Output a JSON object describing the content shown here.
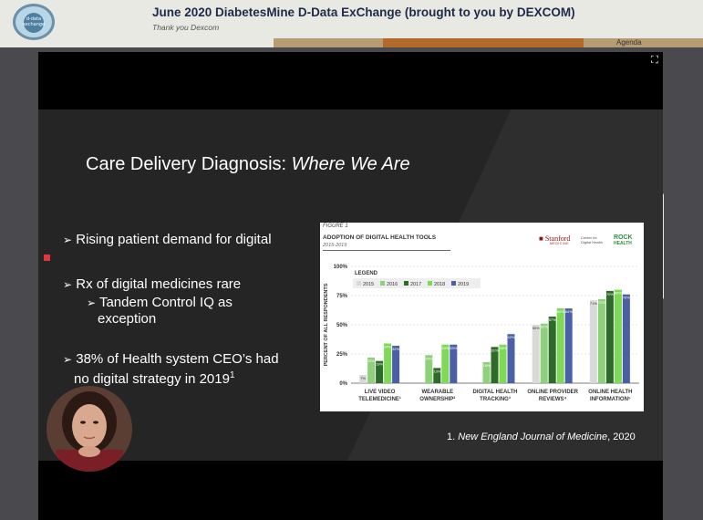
{
  "header": {
    "title": "June 2020 DiabetesMine D-Data ExChange (brought to you by DEXCOM)",
    "subtitle": "Thank you Dexcom",
    "agenda": "Agenda",
    "logo_line1": "d-data",
    "logo_line2": "exchange"
  },
  "slide": {
    "title_plain": "Care Delivery Diagnosis: ",
    "title_italic": "Where We Are",
    "bullets": [
      {
        "text": "Rising patient demand for digital"
      },
      {
        "text": "Rx of digital medicines rare"
      },
      {
        "text": "Tandem Control IQ as"
      },
      {
        "text": "exception"
      },
      {
        "text": "38% of Health system CEO’s had"
      },
      {
        "text": "no digital strategy in 2019"
      }
    ],
    "superscript": "1",
    "arrow": "➢",
    "footnote_num": "1.",
    "footnote_italic": "New England Journal of Medicine",
    "footnote_tail": ", 2020"
  },
  "figure": {
    "label": "FIGURE 1",
    "title": "ADOPTION OF DIGITAL HEALTH TOOLS",
    "years": "2015-2019",
    "stanford": "Stanford",
    "stanford_sub": "MEDICINE",
    "center_line1": "Center for",
    "center_line2": "Digital Health",
    "rock_line1": "ROCK",
    "rock_line2": "HEALTH"
  },
  "chart_data": {
    "type": "bar",
    "ylabel": "PERCENT OF ALL RESPONDENTS",
    "ylim": [
      0,
      100
    ],
    "yticks": [
      "0%",
      "25%",
      "50%",
      "75%",
      "100%"
    ],
    "legend_title": "LEGEND",
    "categories": [
      "LIVE VIDEO TELEMEDICINE",
      "WEARABLE OWNERSHIP",
      "DIGITAL HEALTH TRACKING",
      "ONLINE PROVIDER REVIEWS",
      "ONLINE HEALTH INFORMATION"
    ],
    "category_lines": [
      [
        "LIVE VIDEO",
        "TELEMEDICINE¹"
      ],
      [
        "WEARABLE",
        "OWNERSHIP²"
      ],
      [
        "DIGITAL HEALTH",
        "TRACKING³"
      ],
      [
        "ONLINE PROVIDER",
        "REVIEWS⁴"
      ],
      [
        "ONLINE HEALTH",
        "INFORMATION⁵"
      ]
    ],
    "series": [
      {
        "name": "2015",
        "color": "#d9d9d9",
        "values": [
          7,
          null,
          null,
          50,
          71
        ]
      },
      {
        "name": "2016",
        "color": "#8fd17a",
        "values": [
          22,
          24,
          18,
          51,
          72
        ]
      },
      {
        "name": "2017",
        "color": "#2e6b2a",
        "values": [
          19,
          13,
          31,
          57,
          79
        ]
      },
      {
        "name": "2018",
        "color": "#7ed957",
        "values": [
          34,
          33,
          33,
          64,
          80
        ]
      },
      {
        "name": "2019",
        "color": "#4a5fa6",
        "values": [
          32,
          33,
          42,
          64,
          76
        ]
      }
    ],
    "value_labels": [
      [
        "7%",
        "",
        "",
        "50%",
        "71%"
      ],
      [
        "22%",
        "24%",
        "18%",
        "51%",
        "72%"
      ],
      [
        "19%",
        "13%",
        "31%",
        "57%",
        "79%"
      ],
      [
        "34%",
        "33%",
        "33%",
        "64%",
        "80%"
      ],
      [
        "32%",
        "33%",
        "42%",
        "64%",
        "76%"
      ]
    ],
    "legend_position": "top-left",
    "grid": true
  }
}
